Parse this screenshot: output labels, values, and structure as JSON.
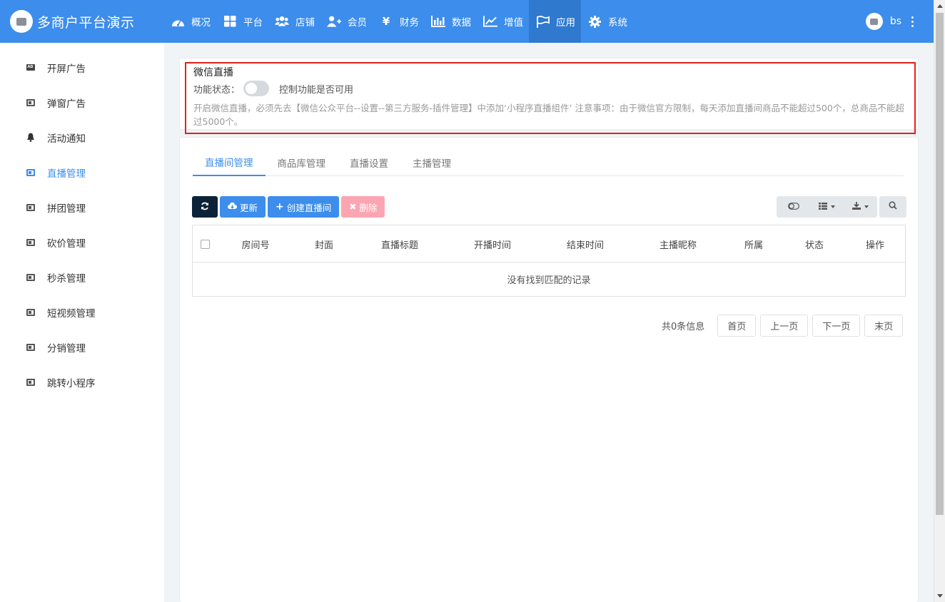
{
  "brand": {
    "title": "多商户平台演示"
  },
  "nav": [
    {
      "label": "概况",
      "icon": "dashboard-icon"
    },
    {
      "label": "平台",
      "icon": "grid-icon"
    },
    {
      "label": "店铺",
      "icon": "users-icon"
    },
    {
      "label": "会员",
      "icon": "user-plus-icon"
    },
    {
      "label": "财务",
      "icon": "yen-icon"
    },
    {
      "label": "数据",
      "icon": "bar-chart-icon"
    },
    {
      "label": "增值",
      "icon": "line-chart-icon"
    },
    {
      "label": "应用",
      "icon": "flag-icon",
      "active": true
    },
    {
      "label": "系统",
      "icon": "gear-icon"
    }
  ],
  "user": {
    "name": "bs"
  },
  "sidebar": [
    {
      "label": "开屏广告",
      "icon": "ad-icon"
    },
    {
      "label": "弹窗广告",
      "icon": "app-icon"
    },
    {
      "label": "活动通知",
      "icon": "bell-icon"
    },
    {
      "label": "直播管理",
      "icon": "app-icon",
      "active": true
    },
    {
      "label": "拼团管理",
      "icon": "app-icon"
    },
    {
      "label": "砍价管理",
      "icon": "app-icon"
    },
    {
      "label": "秒杀管理",
      "icon": "app-icon"
    },
    {
      "label": "短视频管理",
      "icon": "app-icon"
    },
    {
      "label": "分销管理",
      "icon": "app-icon"
    },
    {
      "label": "跳转小程序",
      "icon": "app-icon"
    }
  ],
  "plugin": {
    "title": "微信直播",
    "status_label": "功能状态：",
    "toggle_on": false,
    "toggle_desc": "控制功能是否可用",
    "notice": "开启微信直播，必须先去【微信公众平台--设置--第三方服务-插件管理】中添加‘小程序直播组件’ 注意事项：由于微信官方限制，每天添加直播间商品不能超过500个，总商品不能超过5000个。"
  },
  "tabs": [
    "直播间管理",
    "商品库管理",
    "直播设置",
    "主播管理"
  ],
  "toolbar": {
    "refresh_icon": "refresh-icon",
    "update_label": "更新",
    "create_label": "创建直播间",
    "delete_label": "删除"
  },
  "table": {
    "columns": [
      "房间号",
      "封面",
      "直播标题",
      "开播时间",
      "结束时间",
      "主播昵称",
      "所属",
      "状态",
      "操作"
    ],
    "empty_text": "没有找到匹配的记录"
  },
  "pagination": {
    "info": "共0条信息",
    "first": "首页",
    "prev": "上一页",
    "next": "下一页",
    "last": "末页"
  },
  "colors": {
    "primary": "#3c8dec",
    "dark": "#0b2238",
    "danger": "#fca5b2",
    "highlight": "#e3211a"
  }
}
